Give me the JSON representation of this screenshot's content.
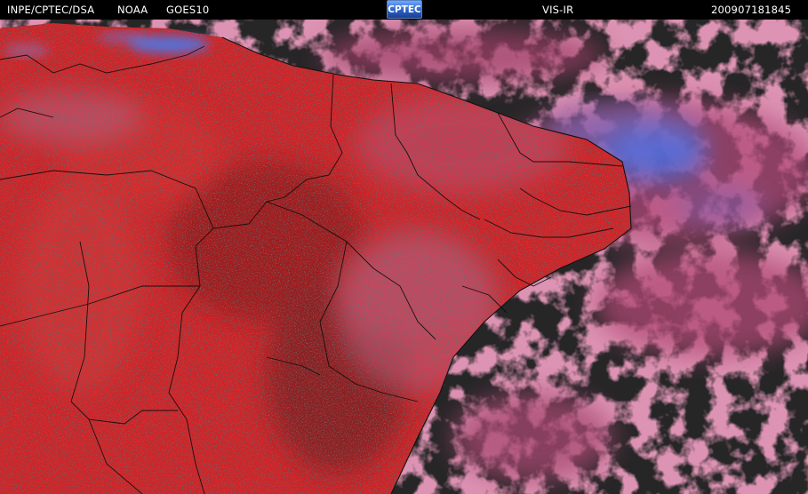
{
  "header": {
    "agency": "INPE/CPTEC/DSA",
    "source": "NOAA",
    "satellite": "GOES10",
    "logo_text": "CPTEC",
    "channel": "VIS-IR",
    "timestamp": "200907181845"
  },
  "colors": {
    "background": "#000000",
    "header_text": "#ffffff",
    "ocean_clear": "#272627",
    "land": "#d0252b",
    "warm_cloud": "#b8456a",
    "cold_cloud": "#3d6be0",
    "border_lines": "#000000"
  }
}
